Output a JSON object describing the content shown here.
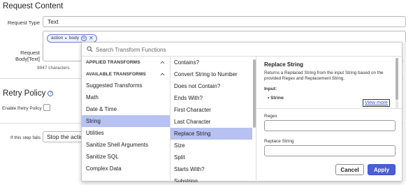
{
  "request": {
    "section_title": "Request Content",
    "type_label": "Request Type",
    "type_value": "Text",
    "body_label": "Request Body[Text]",
    "chip": {
      "part1": "action",
      "part2": "body",
      "icon_text": "ⓦ",
      "remove": "✕"
    },
    "char_count": "9947 characters"
  },
  "retry": {
    "title": "Retry Policy",
    "help": "?",
    "enable_label": "Enable Retry Policy",
    "fails_label": "If this step fails",
    "fails_value": "Stop the action"
  },
  "transform_popup": {
    "search_placeholder": "Search Transform Functions",
    "applied_header": "APPLIED TRANSFORMS",
    "available_header": "AVAILABLE TRANSFORMS",
    "categories": [
      {
        "label": "Suggested Transforms"
      },
      {
        "label": "Math"
      },
      {
        "label": "Date & Time"
      },
      {
        "label": "String",
        "selected": true
      },
      {
        "label": "Utilities"
      },
      {
        "label": "Sanitize Shell Arguments"
      },
      {
        "label": "Sanitize SQL"
      },
      {
        "label": "Complex Data"
      }
    ],
    "functions": [
      {
        "label": "Contains?"
      },
      {
        "label": "Convert String to Number"
      },
      {
        "label": "Does not Contain?"
      },
      {
        "label": "Ends With?"
      },
      {
        "label": "First Character"
      },
      {
        "label": "Last Character"
      },
      {
        "label": "Replace String",
        "selected": true
      },
      {
        "label": "Size"
      },
      {
        "label": "Split"
      },
      {
        "label": "Starts With?"
      },
      {
        "label": "Substring"
      }
    ],
    "detail": {
      "title": "Replace String",
      "description": "Returns a Replaced String from the input String based on the provided Regex and Replacement String.",
      "input_label": "Input:",
      "input_item": "• String",
      "view_more": "View more",
      "regex_label": "Regex",
      "replace_label": "Replace String",
      "regex_value": "",
      "replace_value": "",
      "cancel_label": "Cancel",
      "apply_label": "Apply"
    }
  },
  "colors": {
    "accent": "#4a5fd3",
    "selection": "#b7c2f2",
    "link": "#3950c4"
  }
}
